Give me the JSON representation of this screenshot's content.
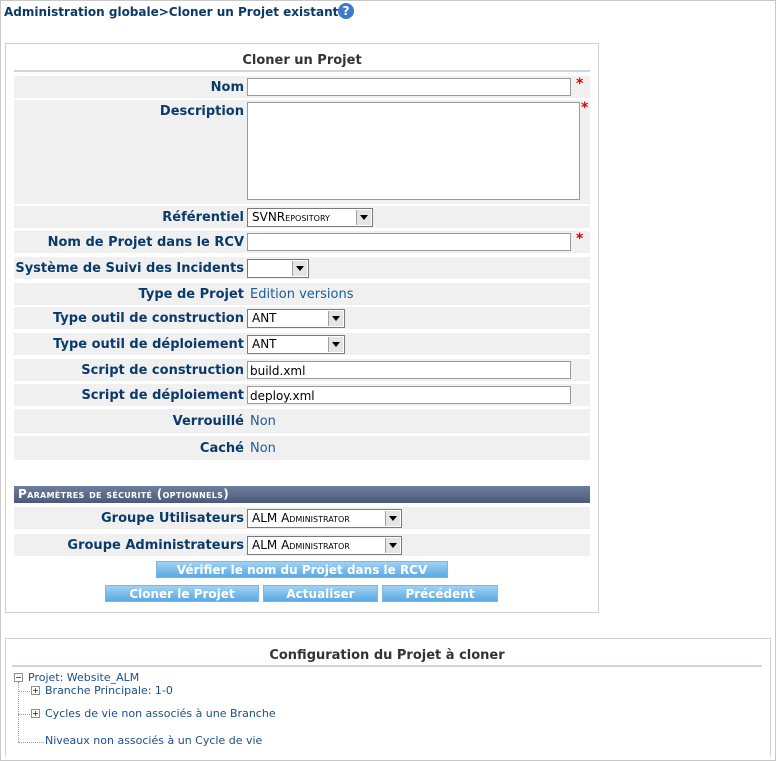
{
  "breadcrumb": "Administration globale>Cloner un Projet existant",
  "help_icon": "question-circle-icon",
  "panel_title": "Cloner un Projet",
  "fields": {
    "nom_label": "Nom",
    "nom_value": "",
    "description_label": "Description",
    "description_value": "",
    "referentiel_label": "Référentiel",
    "referentiel_value": "SVNRepository",
    "rcv_label": "Nom de Projet dans le RCV",
    "rcv_value": "",
    "incidents_label": "Système de Suivi des Incidents",
    "incidents_value": "",
    "type_projet_label": "Type de Projet",
    "type_projet_value": "Edition versions",
    "outil_construction_label": "Type outil de construction",
    "outil_construction_value": "ANT",
    "outil_deploiement_label": "Type outil de déploiement",
    "outil_deploiement_value": "ANT",
    "script_construction_label": "Script de construction",
    "script_construction_value": "build.xml",
    "script_deploiement_label": "Script de déploiement",
    "script_deploiement_value": "deploy.xml",
    "verrouille_label": "Verrouillé",
    "verrouille_value": "Non",
    "cache_label": "Caché",
    "cache_value": "Non"
  },
  "required_mark": "*",
  "security": {
    "header": "Paramètres de sécurité (optionnels)",
    "groupe_utilisateurs_label": "Groupe Utilisateurs",
    "groupe_utilisateurs_value": "ALM Administrator",
    "groupe_admins_label": "Groupe Administrateurs",
    "groupe_admins_value": "ALM Administrator"
  },
  "buttons": {
    "verifier": "Vérifier le nom du Projet dans le RCV",
    "cloner": "Cloner le Projet",
    "actualiser": "Actualiser",
    "precedent": "Précédent"
  },
  "config": {
    "title": "Configuration du Projet à cloner",
    "tree": {
      "root": "Projet: Website_ALM",
      "item1": "Branche Principale: 1-0",
      "item2": "Cycles de vie non associés à une Branche",
      "item3": "Niveaux non associés à un Cycle de vie"
    }
  }
}
